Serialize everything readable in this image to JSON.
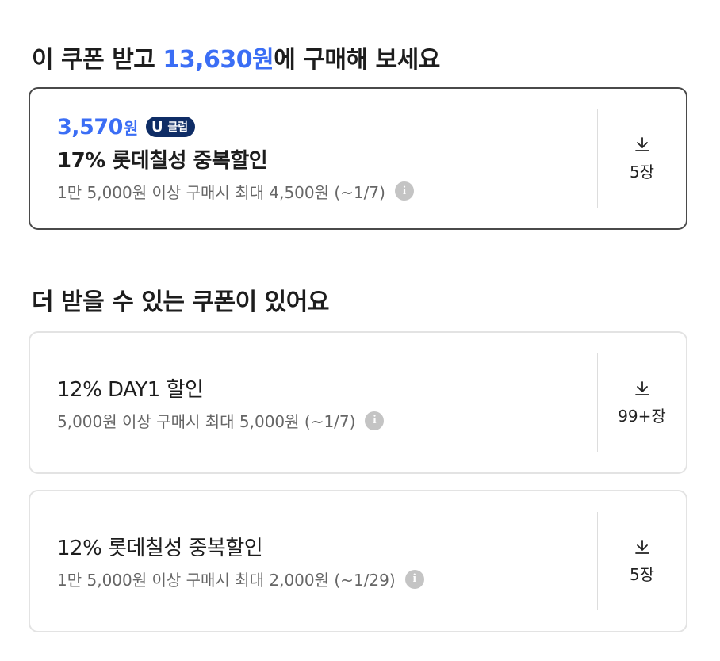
{
  "applied_section": {
    "title_prefix": "이 쿠폰 받고 ",
    "title_price": "13,630원",
    "title_suffix": "에 구매해 보세요"
  },
  "more_section": {
    "title": "더 받을 수 있는 쿠폰이 있어요"
  },
  "coupons": [
    {
      "price_amount": "3,570",
      "price_unit": "원",
      "badge_mark": "U",
      "badge_label": "클럽",
      "name": "17% 롯데칠성 중복할인",
      "condition": "1만 5,000원 이상 구매시 최대 4,500원 (~1/7)",
      "info_glyph": "i",
      "download_count": "5장"
    },
    {
      "name": "12% DAY1 할인",
      "condition": "5,000원 이상 구매시 최대 5,000원 (~1/7)",
      "info_glyph": "i",
      "download_count": "99+장"
    },
    {
      "name": "12% 롯데칠성 중복할인",
      "condition": "1만 5,000원 이상 구매시 최대 2,000원 (~1/29)",
      "info_glyph": "i",
      "download_count": "5장"
    }
  ],
  "icons": {
    "info": "info-icon",
    "download": "download-icon"
  },
  "colors": {
    "accent": "#3b6ef5",
    "badge_bg": "#0f2d66",
    "selected_border": "#4a4a4a",
    "card_border": "#e3e3e3"
  }
}
